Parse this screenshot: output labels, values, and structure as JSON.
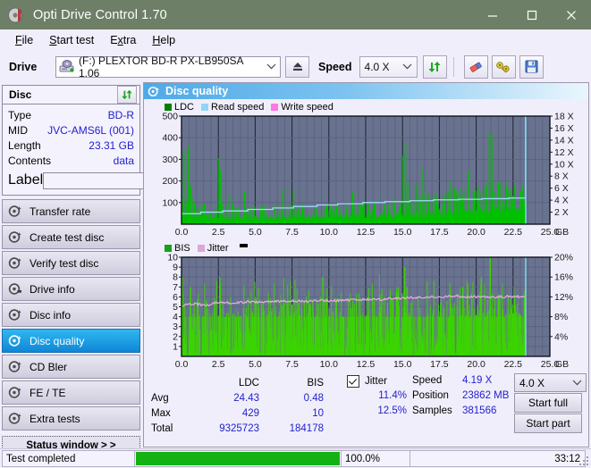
{
  "window": {
    "title": "Opti Drive Control 1.70",
    "icon": "disc-icon",
    "minimize": "–",
    "maximize": "▢",
    "close": "✕",
    "titlebar_color": "#6d7f66"
  },
  "menu": {
    "items": [
      {
        "label": "File",
        "accel": "F"
      },
      {
        "label": "Start test",
        "accel": "S"
      },
      {
        "label": "Extra",
        "accel": "x"
      },
      {
        "label": "Help",
        "accel": "H"
      }
    ]
  },
  "toolbar": {
    "drive_label": "Drive",
    "drive_value": "(F:)  PLEXTOR BD-R  PX-LB950SA 1.06",
    "drive_icon": "drive-icon",
    "eject_icon": "eject-icon",
    "speed_label": "Speed",
    "speed_value": "4.0 X",
    "refresh_icon": "refresh-icon",
    "eraser_icon": "eraser-icon",
    "key_icon": "key-icon",
    "save_icon": "save-icon"
  },
  "sidebar": {
    "disc_panel": {
      "title": "Disc",
      "refresh_icon": "refresh-icon",
      "rows": [
        {
          "key": "Type",
          "value": "BD-R"
        },
        {
          "key": "MID",
          "value": "JVC-AMS6L (001)"
        },
        {
          "key": "Length",
          "value": "23.31 GB"
        },
        {
          "key": "Contents",
          "value": "data"
        }
      ],
      "label_key": "Label",
      "label_value": "",
      "label_placeholder": "",
      "cd_icon": "cd-icon"
    },
    "nav": [
      {
        "label": "Transfer rate",
        "icon": "disc-test-icon",
        "active": false
      },
      {
        "label": "Create test disc",
        "icon": "disc-test-icon",
        "active": false
      },
      {
        "label": "Verify test disc",
        "icon": "disc-test-icon",
        "active": false
      },
      {
        "label": "Drive info",
        "icon": "disc-test-icon",
        "active": false
      },
      {
        "label": "Disc info",
        "icon": "disc-test-icon",
        "active": false
      },
      {
        "label": "Disc quality",
        "icon": "disc-test-icon",
        "active": true
      },
      {
        "label": "CD Bler",
        "icon": "disc-test-icon",
        "active": false
      },
      {
        "label": "FE / TE",
        "icon": "disc-test-icon",
        "active": false
      },
      {
        "label": "Extra tests",
        "icon": "disc-test-icon",
        "active": false
      }
    ],
    "status_window_button": "Status window > >"
  },
  "main": {
    "header": {
      "title": "Disc quality",
      "icon": "disc-quality-icon"
    }
  },
  "stats": {
    "col_headers": [
      "LDC",
      "BIS"
    ],
    "row_labels": [
      "Avg",
      "Max",
      "Total"
    ],
    "ldc": {
      "avg": "24.43",
      "max": "429",
      "total": "9325723"
    },
    "bis": {
      "avg": "0.48",
      "max": "10",
      "total": "184178"
    },
    "jitter": {
      "label": "Jitter",
      "checked": true,
      "avg": "11.4%",
      "max": "12.5%"
    },
    "speed_label": "Speed",
    "speed_value": "4.19 X",
    "position_label": "Position",
    "position_value": "23862 MB",
    "samples_label": "Samples",
    "samples_value": "381566",
    "speed_select": "4.0 X",
    "start_full": "Start full",
    "start_part": "Start part"
  },
  "statusbar": {
    "message": "Test completed",
    "progress_text": "100.0%",
    "progress_percent": 100,
    "elapsed": "33:12"
  },
  "colors": {
    "ldc_green": "#00c000",
    "read_speed_blue": "#84d0f0",
    "write_speed_pink": "#ff6ee0",
    "bis_green": "#2ecc00",
    "jitter_pink": "#d9a8d9",
    "plot_bg": "#69738f",
    "accent": "#2222cc",
    "progress_green": "#12b212"
  },
  "chart_data": [
    {
      "type": "area",
      "id": "ldc-chart",
      "title": "Disc quality - LDC",
      "xlabel": "GB",
      "ylabel": "LDC",
      "legend": [
        {
          "name": "LDC",
          "color": "#00a000"
        },
        {
          "name": "Read speed",
          "color": "#84d0f0"
        },
        {
          "name": "Write speed",
          "color": "#ff6ee0"
        }
      ],
      "legend_position": "top-left",
      "grid": true,
      "xlim": [
        0,
        25.0
      ],
      "xticks": [
        "0.0",
        "2.5",
        "5.0",
        "7.5",
        "10.0",
        "12.5",
        "15.0",
        "17.5",
        "20.0",
        "22.5",
        "25.0"
      ],
      "xtick_values": [
        0,
        2.5,
        5,
        7.5,
        10,
        12.5,
        15,
        17.5,
        20,
        22.5,
        25
      ],
      "xunit": "GB",
      "ylim": [
        0,
        500
      ],
      "yticks": [
        "100",
        "200",
        "300",
        "400",
        "500"
      ],
      "ytick_values": [
        100,
        200,
        300,
        400,
        500
      ],
      "y2lim": [
        0,
        18
      ],
      "y2ticks": [
        "2 X",
        "4 X",
        "6 X",
        "8 X",
        "10 X",
        "12 X",
        "14 X",
        "16 X",
        "18 X"
      ],
      "y2tick_values": [
        2,
        4,
        6,
        8,
        10,
        12,
        14,
        16,
        18
      ],
      "data_end_x": 23.31,
      "series": [
        {
          "name": "LDC",
          "color": "#00c000",
          "kind": "spike-area",
          "baseline": [
            {
              "x": 0.0,
              "y": 46
            },
            {
              "x": 1.0,
              "y": 34
            },
            {
              "x": 3.0,
              "y": 30
            },
            {
              "x": 6.0,
              "y": 30
            },
            {
              "x": 9.0,
              "y": 32
            },
            {
              "x": 12.0,
              "y": 34
            },
            {
              "x": 14.0,
              "y": 40
            },
            {
              "x": 16.0,
              "y": 48
            },
            {
              "x": 18.0,
              "y": 56
            },
            {
              "x": 20.0,
              "y": 62
            },
            {
              "x": 21.5,
              "y": 70
            },
            {
              "x": 23.0,
              "y": 66
            },
            {
              "x": 23.31,
              "y": 60
            }
          ],
          "spikes": [
            {
              "x": 0.15,
              "y": 338
            },
            {
              "x": 0.45,
              "y": 360
            },
            {
              "x": 0.62,
              "y": 176
            },
            {
              "x": 0.7,
              "y": 126
            },
            {
              "x": 1.55,
              "y": 98
            },
            {
              "x": 2.55,
              "y": 305
            },
            {
              "x": 2.62,
              "y": 252
            },
            {
              "x": 2.75,
              "y": 96
            },
            {
              "x": 3.25,
              "y": 140
            },
            {
              "x": 3.45,
              "y": 96
            },
            {
              "x": 4.3,
              "y": 150
            },
            {
              "x": 4.95,
              "y": 84
            },
            {
              "x": 5.55,
              "y": 82
            },
            {
              "x": 6.35,
              "y": 88
            },
            {
              "x": 6.9,
              "y": 160
            },
            {
              "x": 7.35,
              "y": 86
            },
            {
              "x": 7.6,
              "y": 158
            },
            {
              "x": 8.25,
              "y": 96
            },
            {
              "x": 9.1,
              "y": 86
            },
            {
              "x": 9.85,
              "y": 92
            },
            {
              "x": 10.5,
              "y": 84
            },
            {
              "x": 11.6,
              "y": 148
            },
            {
              "x": 12.3,
              "y": 88
            },
            {
              "x": 13.1,
              "y": 96
            },
            {
              "x": 13.8,
              "y": 92
            },
            {
              "x": 14.5,
              "y": 106
            },
            {
              "x": 15.05,
              "y": 316
            },
            {
              "x": 15.2,
              "y": 375
            },
            {
              "x": 15.35,
              "y": 188
            },
            {
              "x": 15.6,
              "y": 112
            },
            {
              "x": 15.9,
              "y": 185
            },
            {
              "x": 16.2,
              "y": 120
            },
            {
              "x": 16.4,
              "y": 258
            },
            {
              "x": 16.7,
              "y": 130
            },
            {
              "x": 17.3,
              "y": 110
            },
            {
              "x": 17.9,
              "y": 142
            },
            {
              "x": 18.3,
              "y": 198
            },
            {
              "x": 18.55,
              "y": 166
            },
            {
              "x": 19.1,
              "y": 128
            },
            {
              "x": 19.5,
              "y": 244
            },
            {
              "x": 19.9,
              "y": 140
            },
            {
              "x": 20.35,
              "y": 150
            },
            {
              "x": 20.7,
              "y": 170
            },
            {
              "x": 20.9,
              "y": 428
            },
            {
              "x": 21.05,
              "y": 410
            },
            {
              "x": 21.2,
              "y": 150
            },
            {
              "x": 21.5,
              "y": 196
            },
            {
              "x": 21.7,
              "y": 192
            },
            {
              "x": 22.1,
              "y": 126
            },
            {
              "x": 22.5,
              "y": 130
            },
            {
              "x": 23.0,
              "y": 150
            }
          ]
        },
        {
          "name": "Read speed",
          "color": "#9fdcf7",
          "kind": "step-line",
          "axis": "right",
          "points": [
            {
              "x": 0.0,
              "y": 1.75
            },
            {
              "x": 1.1,
              "y": 1.75
            },
            {
              "x": 1.3,
              "y": 2.0
            },
            {
              "x": 2.6,
              "y": 2.0
            },
            {
              "x": 2.8,
              "y": 2.2
            },
            {
              "x": 4.3,
              "y": 2.2
            },
            {
              "x": 4.5,
              "y": 2.45
            },
            {
              "x": 6.0,
              "y": 2.45
            },
            {
              "x": 6.2,
              "y": 2.7
            },
            {
              "x": 7.4,
              "y": 2.7
            },
            {
              "x": 7.6,
              "y": 2.95
            },
            {
              "x": 9.0,
              "y": 2.95
            },
            {
              "x": 9.2,
              "y": 3.2
            },
            {
              "x": 10.4,
              "y": 3.2
            },
            {
              "x": 10.6,
              "y": 3.4
            },
            {
              "x": 12.1,
              "y": 3.4
            },
            {
              "x": 12.3,
              "y": 3.6
            },
            {
              "x": 13.6,
              "y": 3.6
            },
            {
              "x": 13.8,
              "y": 3.75
            },
            {
              "x": 15.3,
              "y": 3.75
            },
            {
              "x": 15.5,
              "y": 3.9
            },
            {
              "x": 16.9,
              "y": 3.9
            },
            {
              "x": 17.1,
              "y": 4.05
            },
            {
              "x": 18.6,
              "y": 4.05
            },
            {
              "x": 18.8,
              "y": 4.15
            },
            {
              "x": 20.2,
              "y": 4.15
            },
            {
              "x": 20.4,
              "y": 4.25
            },
            {
              "x": 22.0,
              "y": 4.25
            },
            {
              "x": 22.2,
              "y": 4.35
            },
            {
              "x": 23.2,
              "y": 4.35
            },
            {
              "x": 23.35,
              "y": 18.0
            }
          ]
        },
        {
          "name": "Write speed",
          "color": "#ff6ee0",
          "kind": "step-line",
          "axis": "right",
          "points": []
        }
      ]
    },
    {
      "type": "area",
      "id": "bis-chart",
      "title": "Disc quality - BIS",
      "xlabel": "GB",
      "ylabel": "BIS",
      "legend": [
        {
          "name": "BIS",
          "color": "#2ecc00"
        },
        {
          "name": "Jitter",
          "color": "#d9a8d9"
        }
      ],
      "legend_position": "top-left",
      "grid": true,
      "xlim": [
        0,
        25.0
      ],
      "xticks": [
        "0.0",
        "2.5",
        "5.0",
        "7.5",
        "10.0",
        "12.5",
        "15.0",
        "17.5",
        "20.0",
        "22.5",
        "25.0"
      ],
      "xtick_values": [
        0,
        2.5,
        5,
        7.5,
        10,
        12.5,
        15,
        17.5,
        20,
        22.5,
        25
      ],
      "xunit": "GB",
      "ylim": [
        0,
        10
      ],
      "yticks": [
        "1",
        "2",
        "3",
        "4",
        "5",
        "6",
        "7",
        "8",
        "9",
        "10"
      ],
      "ytick_values": [
        1,
        2,
        3,
        4,
        5,
        6,
        7,
        8,
        9,
        10
      ],
      "y2lim": [
        0,
        20
      ],
      "y2ticks": [
        "4%",
        "8%",
        "12%",
        "16%",
        "20%"
      ],
      "y2tick_values": [
        4,
        8,
        12,
        16,
        20
      ],
      "data_end_x": 23.31,
      "series": [
        {
          "name": "BIS",
          "color": "#3bd400",
          "kind": "dense-bars",
          "base_level": 4,
          "spikes": [
            {
              "x": 0.05,
              "y": 8
            },
            {
              "x": 0.6,
              "y": 7
            },
            {
              "x": 2.6,
              "y": 8
            },
            {
              "x": 5.0,
              "y": 2
            },
            {
              "x": 15.15,
              "y": 9
            },
            {
              "x": 15.3,
              "y": 7
            },
            {
              "x": 19.1,
              "y": 7
            },
            {
              "x": 20.35,
              "y": 8
            },
            {
              "x": 20.95,
              "y": 10
            },
            {
              "x": 21.6,
              "y": 6
            },
            {
              "x": 22.6,
              "y": 6
            }
          ]
        },
        {
          "name": "Jitter",
          "color": "#e0b0e0",
          "kind": "line",
          "axis": "right",
          "points": [
            {
              "x": 0.1,
              "y": 10.3
            },
            {
              "x": 1.0,
              "y": 10.6
            },
            {
              "x": 1.6,
              "y": 10.2
            },
            {
              "x": 2.5,
              "y": 10.9
            },
            {
              "x": 3.5,
              "y": 10.8
            },
            {
              "x": 4.5,
              "y": 11.0
            },
            {
              "x": 5.5,
              "y": 10.9
            },
            {
              "x": 6.5,
              "y": 11.1
            },
            {
              "x": 7.5,
              "y": 11.2
            },
            {
              "x": 8.5,
              "y": 11.1
            },
            {
              "x": 9.5,
              "y": 11.3
            },
            {
              "x": 10.5,
              "y": 11.2
            },
            {
              "x": 11.5,
              "y": 11.4
            },
            {
              "x": 12.5,
              "y": 11.5
            },
            {
              "x": 13.5,
              "y": 11.5
            },
            {
              "x": 14.5,
              "y": 11.7
            },
            {
              "x": 15.5,
              "y": 11.8
            },
            {
              "x": 16.5,
              "y": 12.0
            },
            {
              "x": 17.5,
              "y": 11.9
            },
            {
              "x": 18.5,
              "y": 12.2
            },
            {
              "x": 19.5,
              "y": 12.0
            },
            {
              "x": 20.5,
              "y": 12.1
            },
            {
              "x": 21.5,
              "y": 12.0
            },
            {
              "x": 22.5,
              "y": 12.1
            },
            {
              "x": 23.2,
              "y": 12.0
            }
          ]
        }
      ]
    }
  ]
}
